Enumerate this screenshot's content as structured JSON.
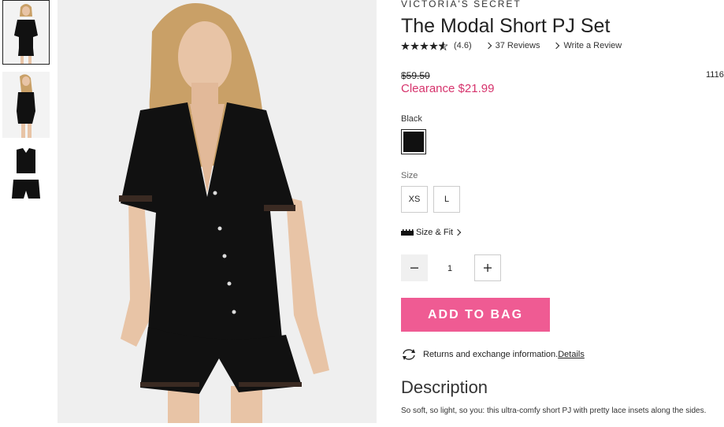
{
  "product": {
    "brand": "VICTORIA'S SECRET",
    "title": "The Modal Short PJ Set",
    "rating": "(4.6)",
    "reviews_link": "37 Reviews",
    "write_review": "Write a Review",
    "old_price": "$59.50",
    "item_number": "1116",
    "clearance_price": "Clearance $21.99",
    "color_label": "Black",
    "size_label": "Size",
    "sizes": [
      "XS",
      "L"
    ],
    "size_fit": "Size & Fit",
    "quantity": "1",
    "add_to_bag": "ADD TO BAG",
    "returns_text": "Returns and exchange information.",
    "details_link": "Details",
    "description_title": "Description",
    "description_text": "So soft, so light, so you: this ultra-comfy short PJ with pretty lace insets along the sides."
  },
  "colors": {
    "accent": "#ef5b93",
    "clearance": "#d6336c",
    "swatch": "#111111"
  },
  "icons": [
    "star-icon",
    "chevron-right-icon",
    "ruler-icon",
    "minus-icon",
    "plus-icon",
    "exchange-icon"
  ]
}
